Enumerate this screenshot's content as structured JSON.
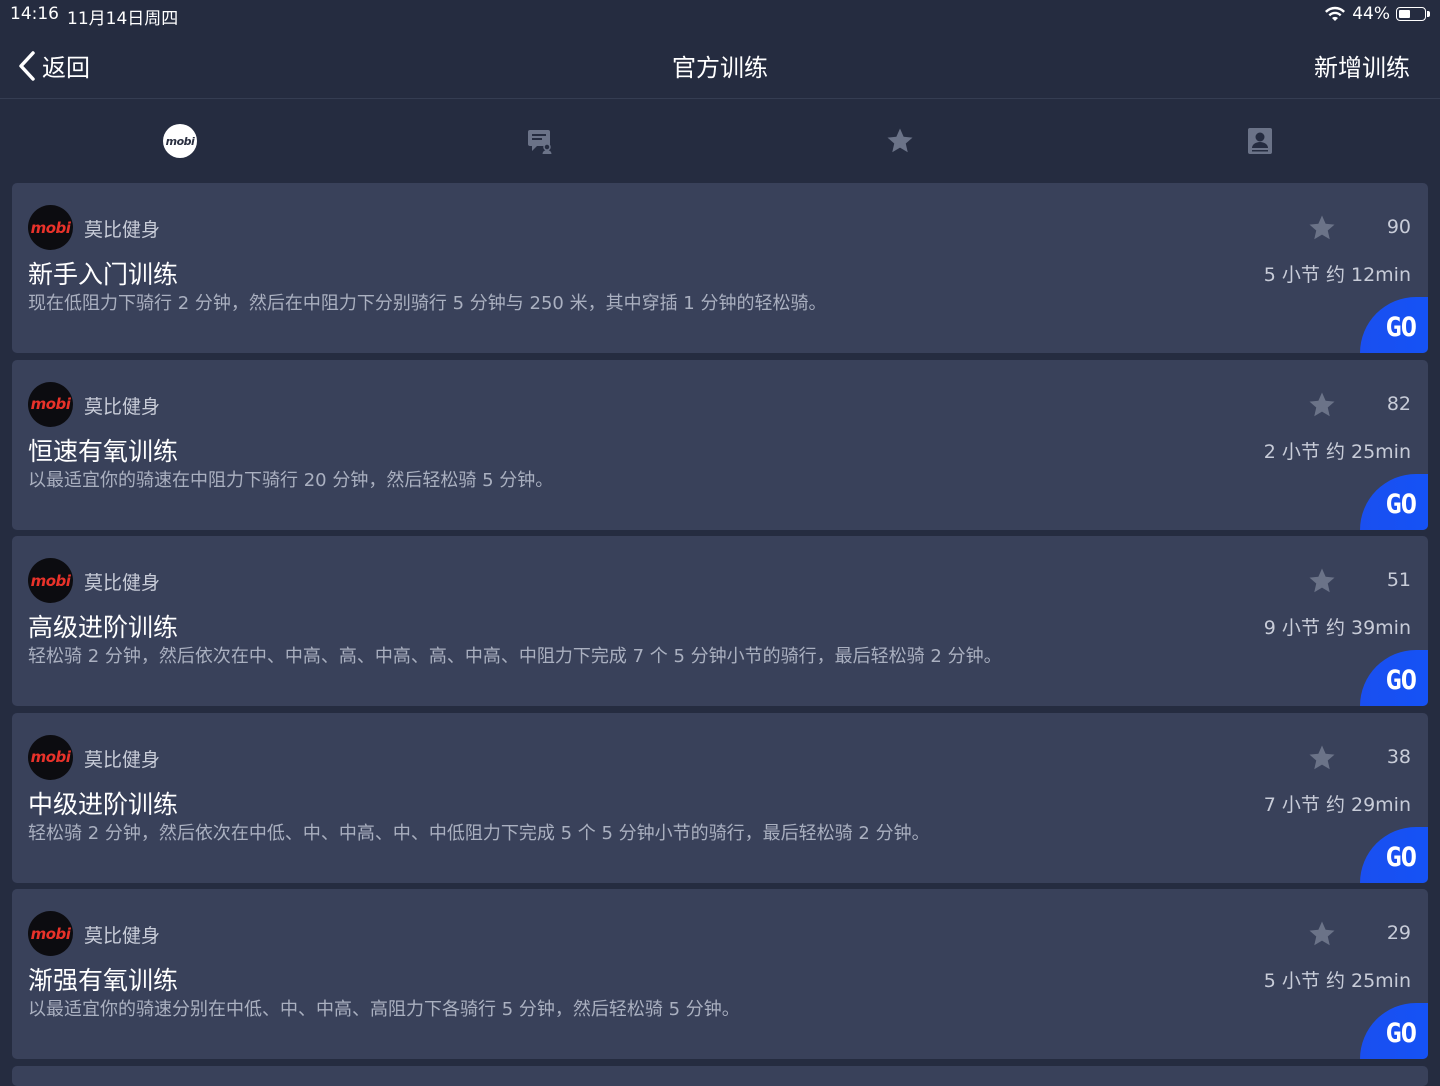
{
  "status_bar": {
    "time": "14:16",
    "date": "11月14日周四",
    "battery": "44%"
  },
  "nav": {
    "back_label": "返回",
    "title": "官方训练",
    "add_label": "新增训练"
  },
  "tabs": [
    {
      "name": "official",
      "label": "mobi",
      "icon": "mobi-logo-icon",
      "active": true
    },
    {
      "name": "community",
      "icon": "chat-user-icon",
      "active": false
    },
    {
      "name": "favorites",
      "icon": "star-icon",
      "active": false
    },
    {
      "name": "mine",
      "icon": "person-badge-icon",
      "active": false
    }
  ],
  "workouts": [
    {
      "author": "莫比健身",
      "avatar_text": "mobi",
      "title": "新手入门训练",
      "description": "现在低阻力下骑行 2 分钟，然后在中阻力下分别骑行 5 分钟与 250 米，其中穿插 1 分钟的轻松骑。",
      "favorites": "90",
      "meta": "5 小节  约 12min",
      "go_label": "GO"
    },
    {
      "author": "莫比健身",
      "avatar_text": "mobi",
      "title": "恒速有氧训练",
      "description": "以最适宜你的骑速在中阻力下骑行 20 分钟，然后轻松骑 5 分钟。",
      "favorites": "82",
      "meta": "2 小节  约 25min",
      "go_label": "GO"
    },
    {
      "author": "莫比健身",
      "avatar_text": "mobi",
      "title": "高级进阶训练",
      "description": "轻松骑 2 分钟，然后依次在中、中高、高、中高、高、中高、中阻力下完成 7 个 5 分钟小节的骑行，最后轻松骑 2 分钟。",
      "favorites": "51",
      "meta": "9 小节  约 39min",
      "go_label": "GO"
    },
    {
      "author": "莫比健身",
      "avatar_text": "mobi",
      "title": "中级进阶训练",
      "description": "轻松骑 2 分钟，然后依次在中低、中、中高、中、中低阻力下完成 5 个 5 分钟小节的骑行，最后轻松骑 2 分钟。",
      "favorites": "38",
      "meta": "7 小节  约 29min",
      "go_label": "GO"
    },
    {
      "author": "莫比健身",
      "avatar_text": "mobi",
      "title": "渐强有氧训练",
      "description": "以最适宜你的骑速分别在中低、中、中高、高阻力下各骑行 5 分钟，然后轻松骑 5 分钟。",
      "favorites": "29",
      "meta": "5 小节  约 25min",
      "go_label": "GO"
    }
  ],
  "colors": {
    "background": "#252c40",
    "card": "#39415a",
    "go_button": "#1a4ff0",
    "avatar_text": "#e8322a",
    "icon_gray": "#6b7388"
  }
}
